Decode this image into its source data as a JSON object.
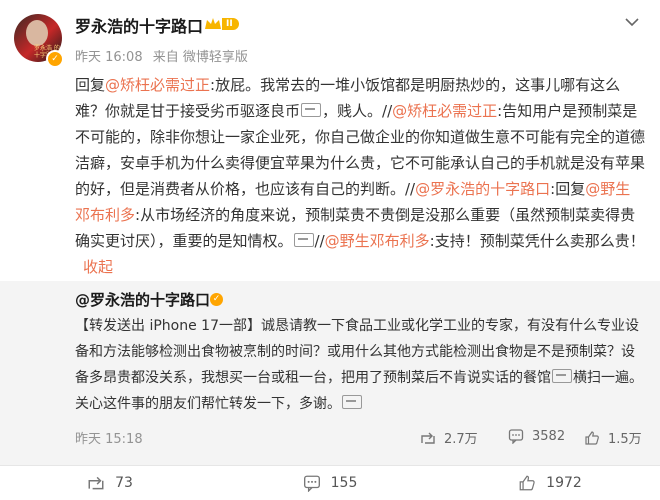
{
  "header": {
    "user_name": "罗永浩的十字路口",
    "level": "II",
    "verified_mark": "✓",
    "avatar_text": "罗永浩 的十字路口",
    "time": "昨天 16:08",
    "source": "来自 微博轻享版"
  },
  "post": {
    "p1": "回复",
    "m1": "@矫枉必需过正",
    "p2": ":放屁。我常去的一堆小饭馆都是明厨热炒的，这事儿哪有这么难？你就是甘于接受劣币驱逐良币",
    "p3": "，贱人。//",
    "m2": "@矫枉必需过正",
    "p4": ":告知用户是预制菜是不可能的，除非你想让一家企业死，你自己做企业的你知道做生意不可能有完全的道德洁癖，安卓手机为什么卖得便宜苹果为什么贵，它不可能承认自己的手机就是没有苹果的好，但是消费者从价格，也应该有自己的判断。//",
    "m3": "@罗永浩的十字路口",
    "p5": ":回复",
    "m4": "@野生邓布利多",
    "p6": ":从市场经济的角度来说，预制菜贵不贵倒是没那么重要（虽然预制菜卖得贵确实更讨厌），重要的是知情权。",
    "p7": "//",
    "m5": "@野生邓布利多",
    "p8": ":支持！预制菜凭什么卖那么贵！",
    "collapse": "收起"
  },
  "repost": {
    "user": "@罗永浩的十字路口",
    "text_a": "【转发送出 iPhone 17一部】诚恳请教一下食品工业或化学工业的专家，有没有什么专业设备和方法能够检测出食物被烹制的时间？或用什么其他方式能检测出食物是不是预制菜？设备多昂贵都没关系，我想买一台或租一台，把用了预制菜后不肯说实话的餐馆",
    "text_b": "横扫一遍。关心这件事的朋友们帮忙转发一下，多谢。",
    "time": "昨天 15:18",
    "reposts": "2.7万",
    "comments": "3582",
    "likes": "1.5万"
  },
  "footer": {
    "reposts": "73",
    "comments": "155",
    "likes": "1972"
  }
}
